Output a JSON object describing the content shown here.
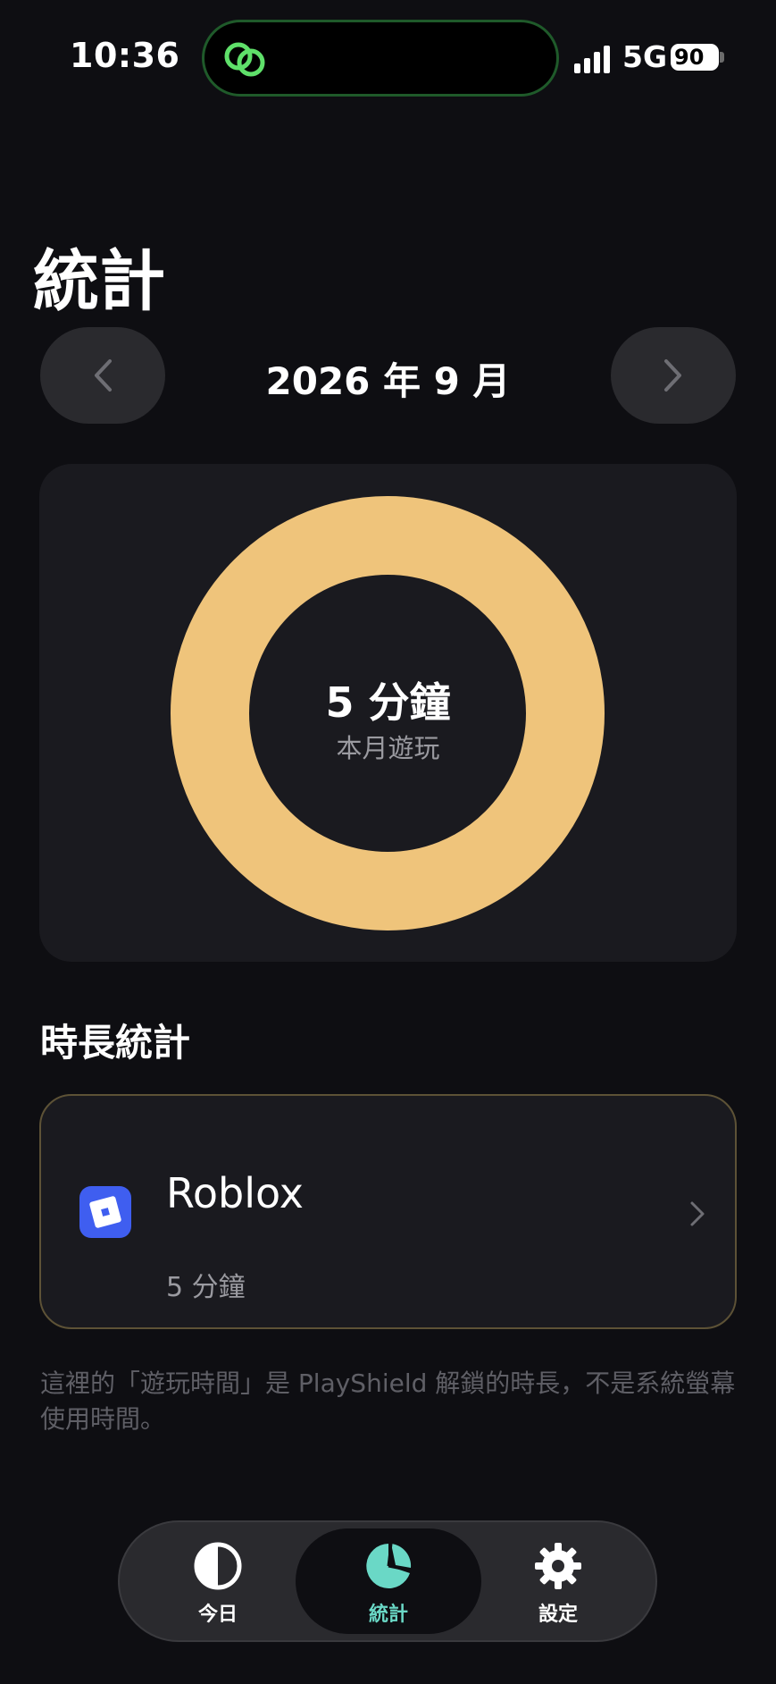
{
  "status_bar": {
    "time": "10:36",
    "network": "5G",
    "battery": "90"
  },
  "header": {
    "title": "統計",
    "month": "2026 年 9 月"
  },
  "summary": {
    "total": "5 分鐘",
    "caption": "本月遊玩",
    "ring_fraction": 1.0,
    "ring_color": "#efc47b"
  },
  "section": {
    "title": "時長統計"
  },
  "apps": [
    {
      "name": "Roblox",
      "duration": "5 分鐘"
    }
  ],
  "note": "這裡的「遊玩時間」是 PlayShield 解鎖的時長，不是系統螢幕使用時間。",
  "tabs": [
    {
      "label": "今日",
      "icon": "half-circle-icon",
      "active": false
    },
    {
      "label": "統計",
      "icon": "pie-chart-icon",
      "active": true
    },
    {
      "label": "設定",
      "icon": "gear-icon",
      "active": false
    }
  ],
  "colors": {
    "accent": "#6ad8c6",
    "ring": "#efc47b",
    "card_border": "#5d5236",
    "background": "#0e0e12"
  }
}
